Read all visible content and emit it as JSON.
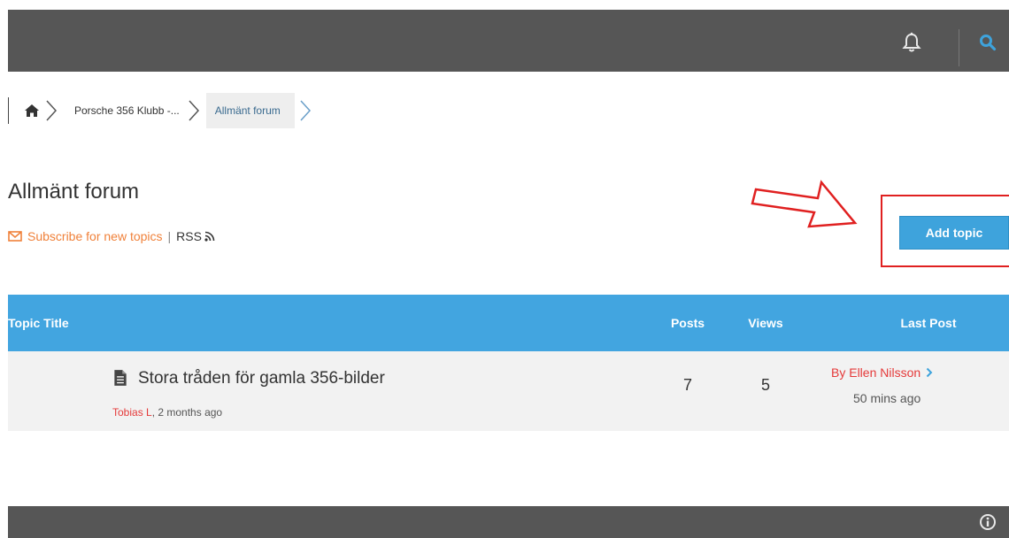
{
  "topbar": {
    "notifications_icon": "bell-icon",
    "search_icon": "search-icon",
    "bg_color": "#565656",
    "accent_color": "#3ea3dc"
  },
  "breadcrumb": {
    "home_icon": "home-icon",
    "items": [
      "Porsche 356 Klubb -...",
      "Allmänt forum"
    ]
  },
  "page": {
    "title": "Allmänt forum",
    "subscribe_label": "Subscribe for new topics",
    "separator": "|",
    "rss_label": "RSS"
  },
  "actions": {
    "add_topic_label": "Add topic"
  },
  "table": {
    "columns": [
      "Topic Title",
      "Posts",
      "Views",
      "Last Post"
    ],
    "rows": [
      {
        "title": "Stora tråden för gamla 356-bilder",
        "author": "Tobias L",
        "age": ", 2 months ago",
        "posts": "7",
        "views": "5",
        "last_by": "By Ellen Nilsson",
        "last_time": "50 mins ago"
      }
    ],
    "header_color": "#42a5e0"
  },
  "footer": {
    "info_icon": "info-icon"
  }
}
